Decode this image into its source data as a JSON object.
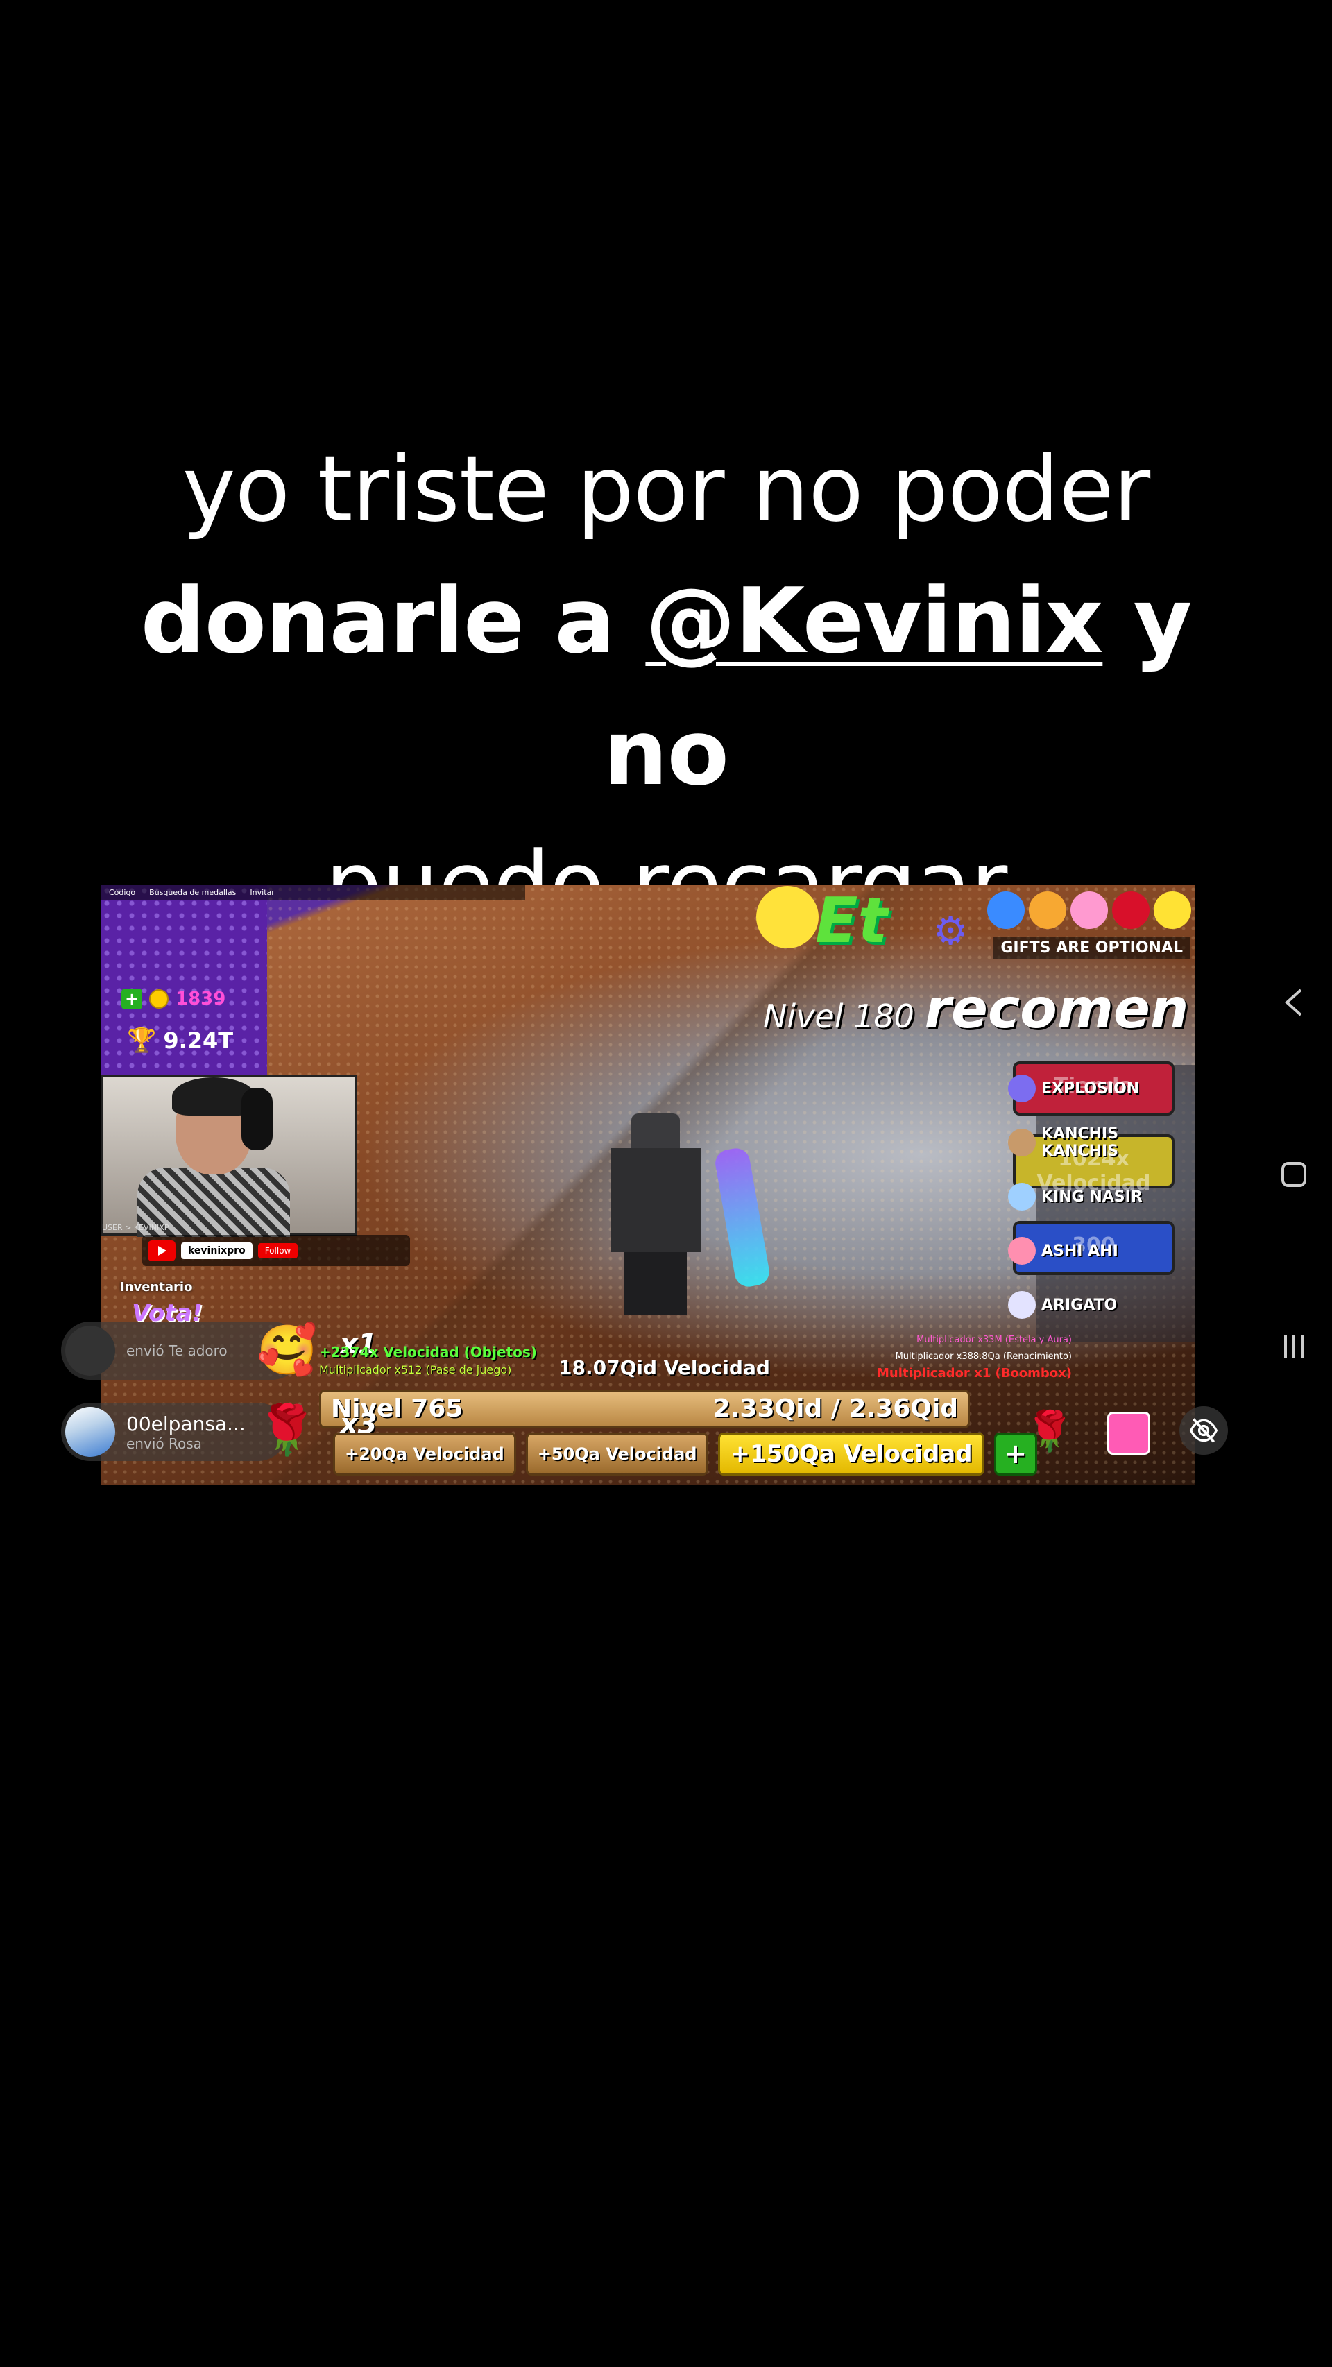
{
  "caption": {
    "line1": "yo triste por no poder",
    "line2_pre": "donarle a ",
    "mention": "@Kevinix",
    "line2_post": " y no",
    "line3": "puedo recargar"
  },
  "stream": {
    "top_menu": [
      "Código",
      "Búsqueda de medallas",
      "Invitar"
    ],
    "coins": "1839",
    "trophies": "9.24T",
    "user_tag": "USER > KEVINIXP",
    "channel_name": "kevinixpro",
    "follow_label": "Follow",
    "inventory_label": "Inventario",
    "vote_label": "Vota!",
    "level_banner_prefix": "Nivel 180",
    "level_banner_word": "recomen",
    "gifts_optional": "GIFTS ARE OPTIONAL",
    "boost_labels": [
      "Tienda",
      "1024x Velocidad",
      "300"
    ],
    "feed": [
      "EXPLOSION",
      "KANCHIS KANCHIS",
      "KING NASIR",
      "ASHI AHI",
      "ARIGATO"
    ],
    "vel_objects": "+2374x Velocidad (Objetos)",
    "mult_pase": "Multiplicador x512 (Pase de juego)",
    "x1": "x1",
    "x3": "x3",
    "speed_total": "18.07Qid Velocidad",
    "mult_estela": "Multiplicador x33M (Estela y Aura)",
    "mult_renacimiento": "Multiplicador x388.8Qa (Renacimiento)",
    "mult_boombox": "Multiplicador x1 (Boombox)",
    "level": "Nivel 765",
    "progress": "2.33Qid / 2.36Qid",
    "progress_fraction": 0.987,
    "buttons": [
      "+20Qa Velocidad",
      "+50Qa Velocidad",
      "+150Qa Velocidad"
    ],
    "plus_label": "+"
  },
  "gift_notifications": [
    {
      "user": "",
      "action": "envió Te adoro",
      "gift_icon": "hug-face"
    },
    {
      "user": "00elpansa...",
      "action": "envió Rosa",
      "gift_icon": "rose"
    }
  ],
  "icons": {
    "back": "chevron-left-icon",
    "home": "square-icon",
    "recents": "three-lines-icon",
    "hide_ui": "eye-off-icon"
  }
}
